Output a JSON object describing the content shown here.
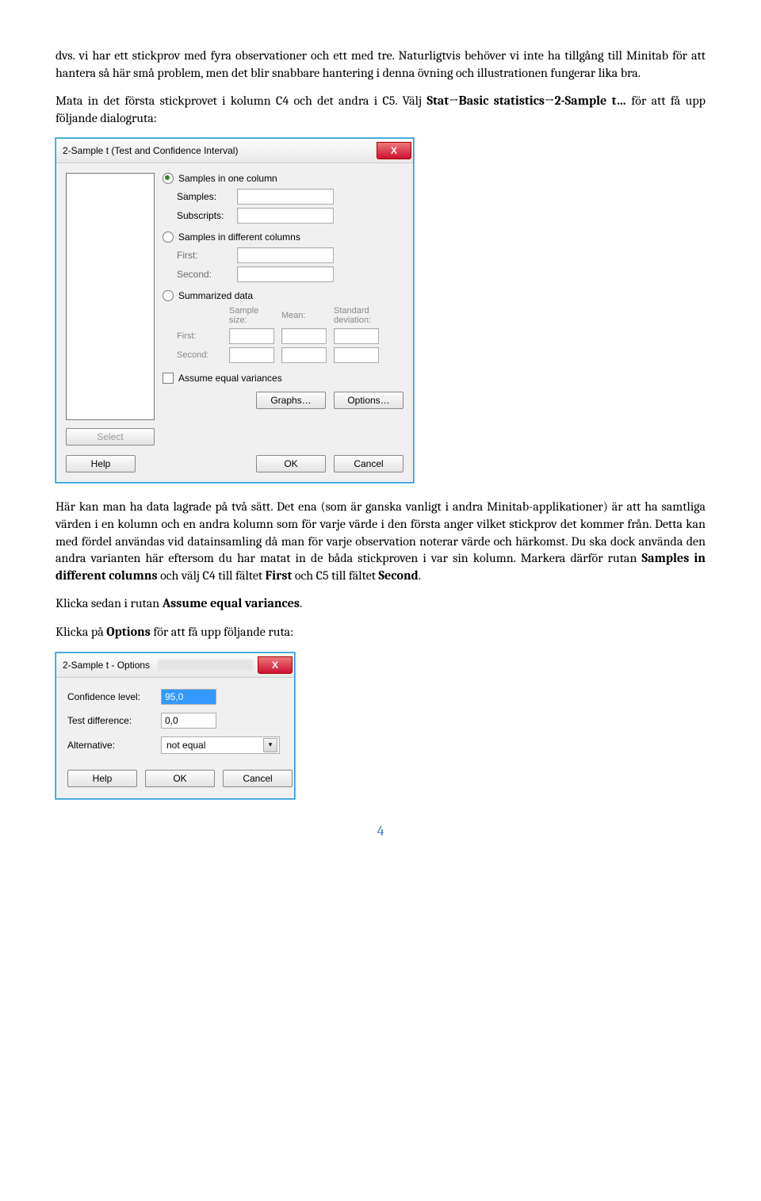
{
  "para1": "dvs. vi har ett stickprov med fyra observationer och ett med tre. Naturligtvis behöver vi inte ha tillgång till Minitab för att hantera så här små problem, men det blir snabbare hantering i denna övning och illustrationen fungerar lika bra.",
  "para2_a": "Mata in det första stickprovet i kolumn C4 och det andra i C5. Välj ",
  "para2_bold1": "Stat→Basic statistics→2-Sample t…",
  "para2_b": " för att få upp följande dialogruta:",
  "dialog1": {
    "title": "2-Sample t (Test and Confidence Interval)",
    "close": "X",
    "radio1": "Samples in one column",
    "samples": "Samples:",
    "subscripts": "Subscripts:",
    "radio2": "Samples in different columns",
    "first": "First:",
    "second": "Second:",
    "radio3": "Summarized data",
    "sampsize": "Sample size:",
    "mean": "Mean:",
    "stddev": "Standard\ndeviation:",
    "assume": "Assume equal variances",
    "select": "Select",
    "graphs": "Graphs…",
    "options": "Options…",
    "help": "Help",
    "ok": "OK",
    "cancel": "Cancel"
  },
  "para3_a": "Här kan man ha data lagrade på två sätt. Det ena (som är ganska vanligt i andra Minitab-applikationer) är att ha samtliga värden i en kolumn och en andra kolumn som för varje värde i den första anger vilket stickprov det kommer från. Detta kan med fördel användas vid datainsamling då man för varje observation noterar värde och härkomst. Du ska dock använda den andra varianten här eftersom du har matat in de båda stickproven i var sin kolumn. Markera därför rutan ",
  "para3_bold1": "Samples in different columns",
  "para3_b": " och välj C4 till fältet ",
  "para3_bold2": "First",
  "para3_c": " och C5 till fältet ",
  "para3_bold3": "Second",
  "para3_d": ".",
  "para4_a": "Klicka sedan i rutan ",
  "para4_bold": "Assume equal variances",
  "para4_b": ".",
  "para5_a": "Klicka på ",
  "para5_bold": "Options",
  "para5_b": " för att få upp följande ruta:",
  "dialog2": {
    "title": "2-Sample t - Options",
    "close": "X",
    "conf_label": "Confidence level:",
    "conf_val": "95,0",
    "diff_label": "Test difference:",
    "diff_val": "0,0",
    "alt_label": "Alternative:",
    "alt_val": "not equal",
    "help": "Help",
    "ok": "OK",
    "cancel": "Cancel"
  },
  "pagenum": "4"
}
